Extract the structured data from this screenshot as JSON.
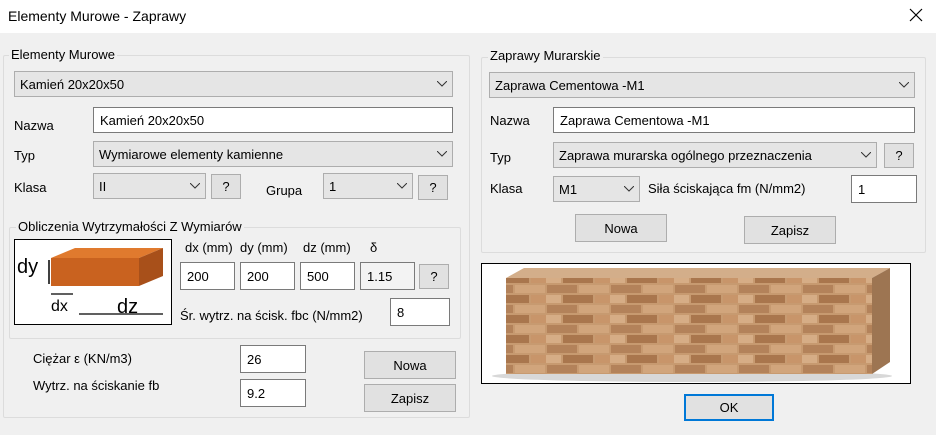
{
  "window": {
    "title": "Elementy Murowe - Zaprawy",
    "close_icon": "close-icon"
  },
  "elements": {
    "legend": "Elementy Murowe",
    "selected": "Kamień 20x20x50",
    "nazwa_label": "Nazwa",
    "nazwa_value": "Kamień 20x20x50",
    "typ_label": "Typ",
    "typ_value": "Wymiarowe elementy kamienne",
    "klasa_label": "Klasa",
    "klasa_value": "II",
    "klasa_help": "?",
    "grupa_label": "Grupa",
    "grupa_value": "1",
    "grupa_help": "?",
    "calc": {
      "legend": "Obliczenia Wytrzymałości Z Wymiarów",
      "img_dy": "dy",
      "img_dx": "dx",
      "img_dz": "dz",
      "dx_label": "dx (mm)",
      "dy_label": "dy (mm)",
      "dz_label": "dz (mm)",
      "delta_label": "δ",
      "dx_value": "200",
      "dy_value": "200",
      "dz_value": "500",
      "delta_value": "1.15",
      "delta_help": "?",
      "fbc_label": "Śr. wytrz. na ścisk. fbc (N/mm2)",
      "fbc_value": "8"
    },
    "ciezar_label": "Ciężar ε (KN/m3)",
    "ciezar_value": "26",
    "fb_label": "Wytrz. na ściskanie fb",
    "fb_value": "9.2",
    "nowa_button": "Nowa",
    "zapisz_button": "Zapisz"
  },
  "mortar": {
    "legend": "Zaprawy Murarskie",
    "selected": "Zaprawa Cementowa -M1",
    "nazwa_label": "Nazwa",
    "nazwa_value": "Zaprawa Cementowa -M1",
    "typ_label": "Typ",
    "typ_value": "Zaprawa murarska ogólnego przeznaczenia",
    "typ_help": "?",
    "klasa_label": "Klasa",
    "klasa_value": "M1",
    "fm_label": "Siła ściskająca fm (N/mm2)",
    "fm_value": "1",
    "nowa_button": "Nowa",
    "zapisz_button": "Zapisz"
  },
  "ok_button": "OK",
  "colors": {
    "brick": "#d2691e",
    "focus_border": "#0078d7",
    "control_bg": "#e5e5e5"
  }
}
